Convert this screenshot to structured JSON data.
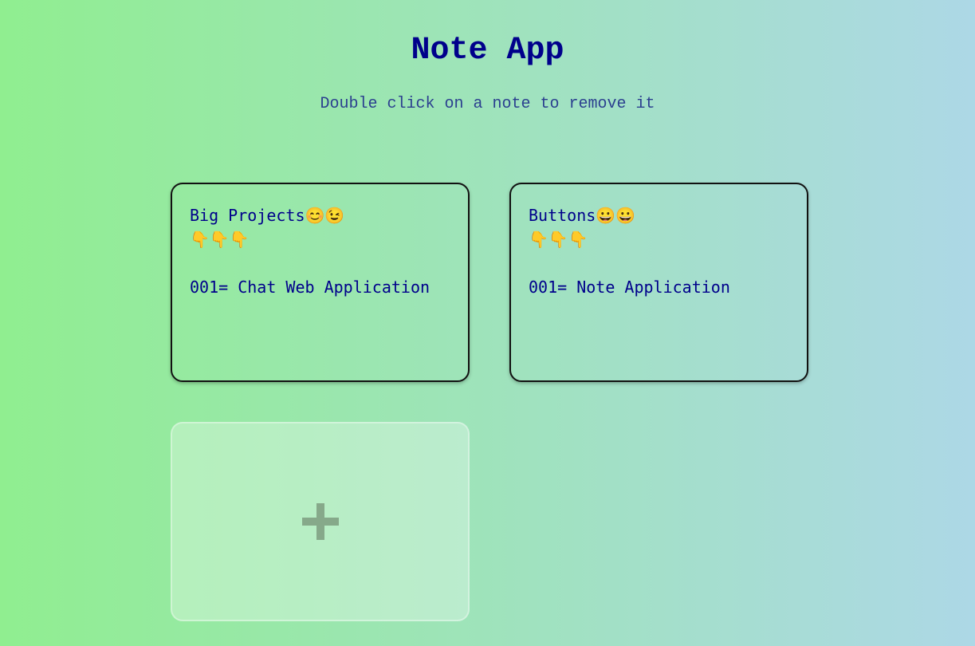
{
  "header": {
    "title": "Note App",
    "subtitle": "Double click on a note to remove it"
  },
  "notes": [
    {
      "content": "Big Projects😊😉\n👇👇👇\n\n001= Chat Web Application"
    },
    {
      "content": "Buttons😀😀\n👇👇👇\n\n001= Note Application"
    }
  ],
  "add_button": {
    "icon": "plus-icon"
  },
  "colors": {
    "title": "#00008b",
    "gradient_start": "#90ee90",
    "gradient_end": "#add8e6"
  }
}
